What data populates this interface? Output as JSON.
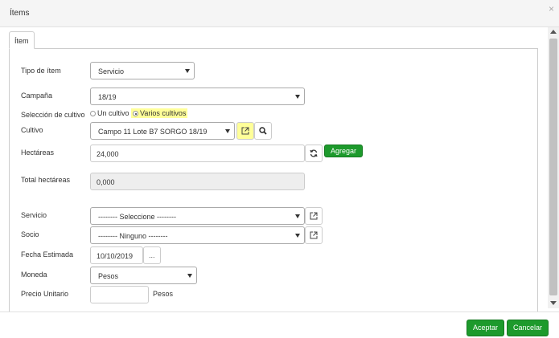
{
  "dialog": {
    "title": "Ítems",
    "close_glyph": "×"
  },
  "tab": {
    "label": "Ítem"
  },
  "form": {
    "tipo_item": {
      "label": "Tipo de ítem",
      "value": "Servicio"
    },
    "campana": {
      "label": "Campaña",
      "value": "18/19"
    },
    "seleccion_cultivo": {
      "label": "Selección de cultivo",
      "option_1": "Un cultivo",
      "option_2": "Varios cultivos",
      "selected": "Varios cultivos"
    },
    "cultivo": {
      "label": "Cultivo",
      "value": "Campo 11 Lote B7 SORGO 18/19"
    },
    "hectareas": {
      "label": "Hectáreas",
      "value": "24,000",
      "add_label": "Agregar"
    },
    "total_hectareas": {
      "label": "Total hectáreas",
      "value": "0,000"
    },
    "servicio": {
      "label": "Servicio",
      "value": "-------- Seleccione --------"
    },
    "socio": {
      "label": "Socio",
      "value": "-------- Ninguno --------"
    },
    "fecha_estimada": {
      "label": "Fecha Estimada",
      "value": "10/10/2019",
      "picker_label": "..."
    },
    "moneda": {
      "label": "Moneda",
      "value": "Pesos"
    },
    "precio_unitario": {
      "label": "Precio Unitario",
      "value": "",
      "unit": "Pesos"
    }
  },
  "footer": {
    "accept_label": "Aceptar",
    "cancel_label": "Cancelar"
  },
  "colors": {
    "primary_green": "#1d9a2c",
    "highlight_yellow": "#ffff99"
  },
  "icons": [
    "close-icon",
    "external-link-icon",
    "search-icon",
    "refresh-icon",
    "caret-down-icon"
  ]
}
